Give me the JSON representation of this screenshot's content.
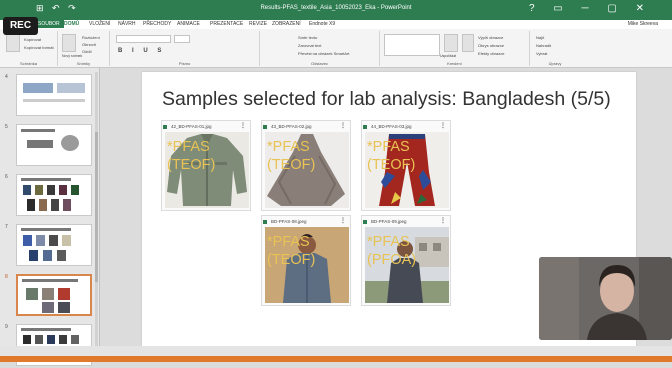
{
  "titlebar": {
    "qat": "⊞ ↶ ↷",
    "doc_title": "Results-PFAS_textile_Asia_10052023_Eka - PowerPoint",
    "window_controls": "? ▭ ─ ▢ ✕"
  },
  "rec": "REC",
  "ribbon_tabs": [
    "SOUBOR",
    "DOMŮ",
    "VLOŽENÍ",
    "NÁVRH",
    "PŘECHODY",
    "ANIMACE",
    "PREZENTACE",
    "REVIZE",
    "ZOBRAZENÍ",
    "Endnote X9"
  ],
  "active_tab": "DOMŮ",
  "user": "Mike Skreeva",
  "ribbon": {
    "groups": [
      "Schránka",
      "Snímky",
      "Písmo",
      "Odstavec",
      "Kreslení",
      "Úpravy"
    ],
    "items": [
      "Kopírovat",
      "Kopírovat formát",
      "Nový snímek",
      "Obnovit",
      "Oddíl",
      "Rozložení",
      "Směr textu",
      "Zarovnat text",
      "Převést na obrázek SmartArt",
      "Uspořádat",
      "Rychlé styly",
      "Výplň obrazce",
      "Obrys obrazce",
      "Efekty obrazce",
      "Najít",
      "Nahradit",
      "Vybrat"
    ]
  },
  "thumbnails": [
    {
      "num": "4"
    },
    {
      "num": "5"
    },
    {
      "num": "6"
    },
    {
      "num": "7"
    },
    {
      "num": "8"
    },
    {
      "num": "9"
    }
  ],
  "slide": {
    "title": "Samples selected for lab analysis: Bangladesh (5/5)",
    "cards": [
      {
        "filename": "42_BD-PFAS-01.jpg",
        "overlay": [
          "*PFAS",
          "(TEOF)"
        ]
      },
      {
        "filename": "43_BD-PFAS-02.jpg",
        "overlay": [
          "*PFAS",
          "(TEOF)"
        ]
      },
      {
        "filename": "44_BD-PFAS-03.jpg",
        "overlay": [
          "*PFAS",
          "(TEOF)"
        ]
      },
      {
        "filename": "BD-PFAS-08.jpeg",
        "overlay": [
          "*PFAS",
          "(TEOF)"
        ]
      },
      {
        "filename": "BD-PFAS-09.jpeg",
        "overlay": [
          "*PFAS",
          "(PFOA)"
        ]
      }
    ]
  },
  "colors": {
    "accent_green": "#2e7d51",
    "overlay_yellow": "#e8c253",
    "active_thumb_border": "#d9864d",
    "footer_orange": "#e07a2a"
  }
}
